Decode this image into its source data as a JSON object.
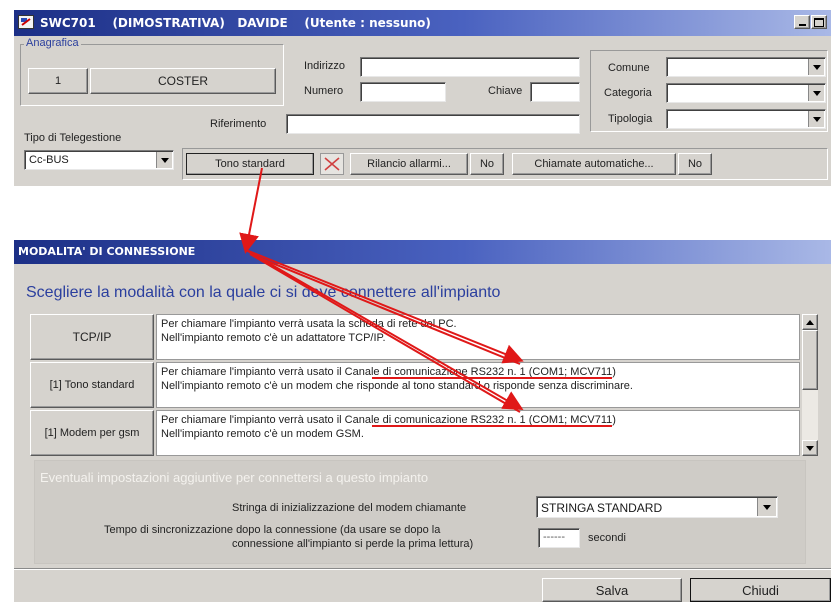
{
  "window1": {
    "title": "SWC701    (DIMOSTRATIVA)   DAVIDE    (Utente : nessuno)",
    "anagrafica_label": "Anagrafica",
    "code": "1",
    "name": "COSTER",
    "indirizzo_label": "Indirizzo",
    "indirizzo_value": "",
    "numero_label": "Numero",
    "numero_value": "",
    "chiave_label": "Chiave",
    "chiave_value": "",
    "riferimento_label": "Riferimento",
    "riferimento_value": "",
    "comune_label": "Comune",
    "categoria_label": "Categoria",
    "tipologia_label": "Tipologia",
    "tipo_telegestione_label": "Tipo di Telegestione",
    "tipo_telegestione_value": "Cc-BUS",
    "tono_button": "Tono standard",
    "rilancio_button": "Rilancio allarmi...",
    "rilancio_value": "No",
    "chiamate_button": "Chiamate automatiche...",
    "chiamate_value": "No"
  },
  "window2": {
    "title": "MODALITA' DI CONNESSIONE",
    "heading": "Scegliere la modalità con la quale ci si deve connettere all'impianto",
    "options": [
      {
        "label": "TCP/IP",
        "line1": "Per chiamare l'impianto verrà usata la scheda di rete del PC.",
        "line2": "Nell'impianto remoto c'è un adattatore TCP/IP."
      },
      {
        "label": "[1] Tono standard",
        "line1": "Per chiamare l'impianto verrà usato il Canale di comunicazione RS232 n. 1   (COM1; MCV711)",
        "line2": "Nell'impianto remoto c'è un modem che risponde al tono standard o risponde senza discriminare."
      },
      {
        "label": "[1] Modem per gsm",
        "line1": "Per chiamare l'impianto verrà usato il Canale di comunicazione RS232 n. 1   (COM1; MCV711)",
        "line2": "Nell'impianto remoto c'è un modem GSM."
      }
    ],
    "extra_title": "Eventuali impostazioni aggiuntive per connettersi a questo impianto",
    "stringa_label": "Stringa di inizializzazione del modem chiamante",
    "stringa_value": "STRINGA STANDARD",
    "tempo_label_line1": "Tempo di sincronizzazione dopo la connessione (da usare se dopo la",
    "tempo_label_line2": "connessione all'impianto si perde la prima lettura)",
    "tempo_value": "------",
    "secondi_label": "secondi",
    "salva_button": "Salva",
    "chiudi_button": "Chiudi"
  },
  "colors": {
    "titlebar": "#1c2f86",
    "annotation": "#e01818",
    "heading": "#2b3f9e"
  },
  "icons": [
    "app-icon",
    "minimize-icon",
    "maximize-icon",
    "dropdown-arrow-icon",
    "cross-icon",
    "scroll-up-icon",
    "scroll-down-icon"
  ]
}
